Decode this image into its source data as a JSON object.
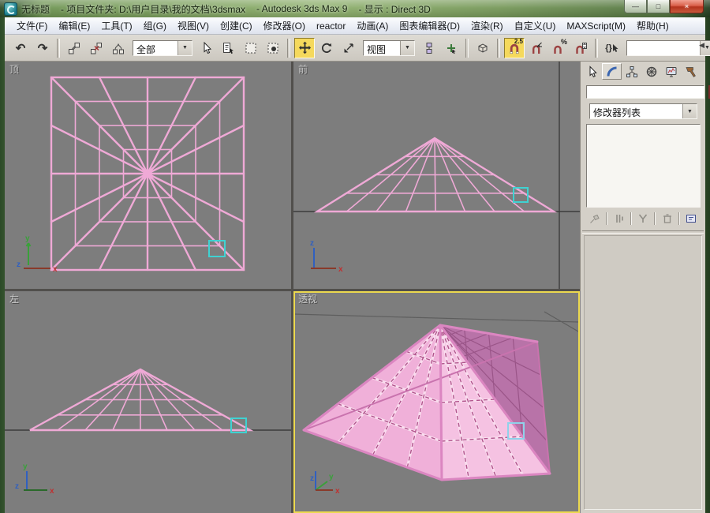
{
  "titlebar": {
    "parts": [
      "无标题",
      "- 项目文件夹: D:\\用户目录\\我的文档\\3dsmax",
      "- Autodesk 3ds Max 9",
      "- 显示 : Direct 3D"
    ]
  },
  "menubar": {
    "items": [
      "文件(F)",
      "编辑(E)",
      "工具(T)",
      "组(G)",
      "视图(V)",
      "创建(C)",
      "修改器(O)",
      "reactor",
      "动画(A)",
      "图表编辑器(D)",
      "渲染(R)",
      "自定义(U)",
      "MAXScript(M)",
      "帮助(H)"
    ]
  },
  "toolbar": {
    "selection_filter_value": "全部",
    "coord_system_value": "视图",
    "named_sets_value": "",
    "snap_label": "2.5",
    "percent_label": "%"
  },
  "command_panel": {
    "object_name": "",
    "modifier_list_label": "修改器列表"
  },
  "viewports": {
    "top": {
      "label": "顶"
    },
    "front": {
      "label": "前"
    },
    "left": {
      "label": "左"
    },
    "perspective": {
      "label": "透视"
    },
    "axis": {
      "x": "x",
      "y": "y",
      "z": "z"
    }
  },
  "icons": {
    "undo": "↶",
    "redo": "↷",
    "dropdown_arrow": "▼",
    "minimize": "—",
    "maximize": "□",
    "close": "×",
    "scroll_left": "◀",
    "named_sets": "{}"
  },
  "colors": {
    "wireframe": "#efa9d6",
    "wireframe-light": "#f9dcee",
    "selection": "#3fd2d2",
    "selection-soft": "#8fd2ea",
    "active-border": "#ecd94f",
    "viewport-bg": "#7d7d7d",
    "ground-line": "#3c3c3c",
    "face-fl": "#f0b0d9",
    "face-fr": "#f5c2e2",
    "face-bl": "#c47fb2",
    "face-br": "#b873a8",
    "grid-dash": "#b1538c",
    "grid-back": "#9a5588",
    "object-swatch": "#e24b4b",
    "snap-active": "#f5d95c",
    "panel-bg": "#d4d0c8"
  }
}
